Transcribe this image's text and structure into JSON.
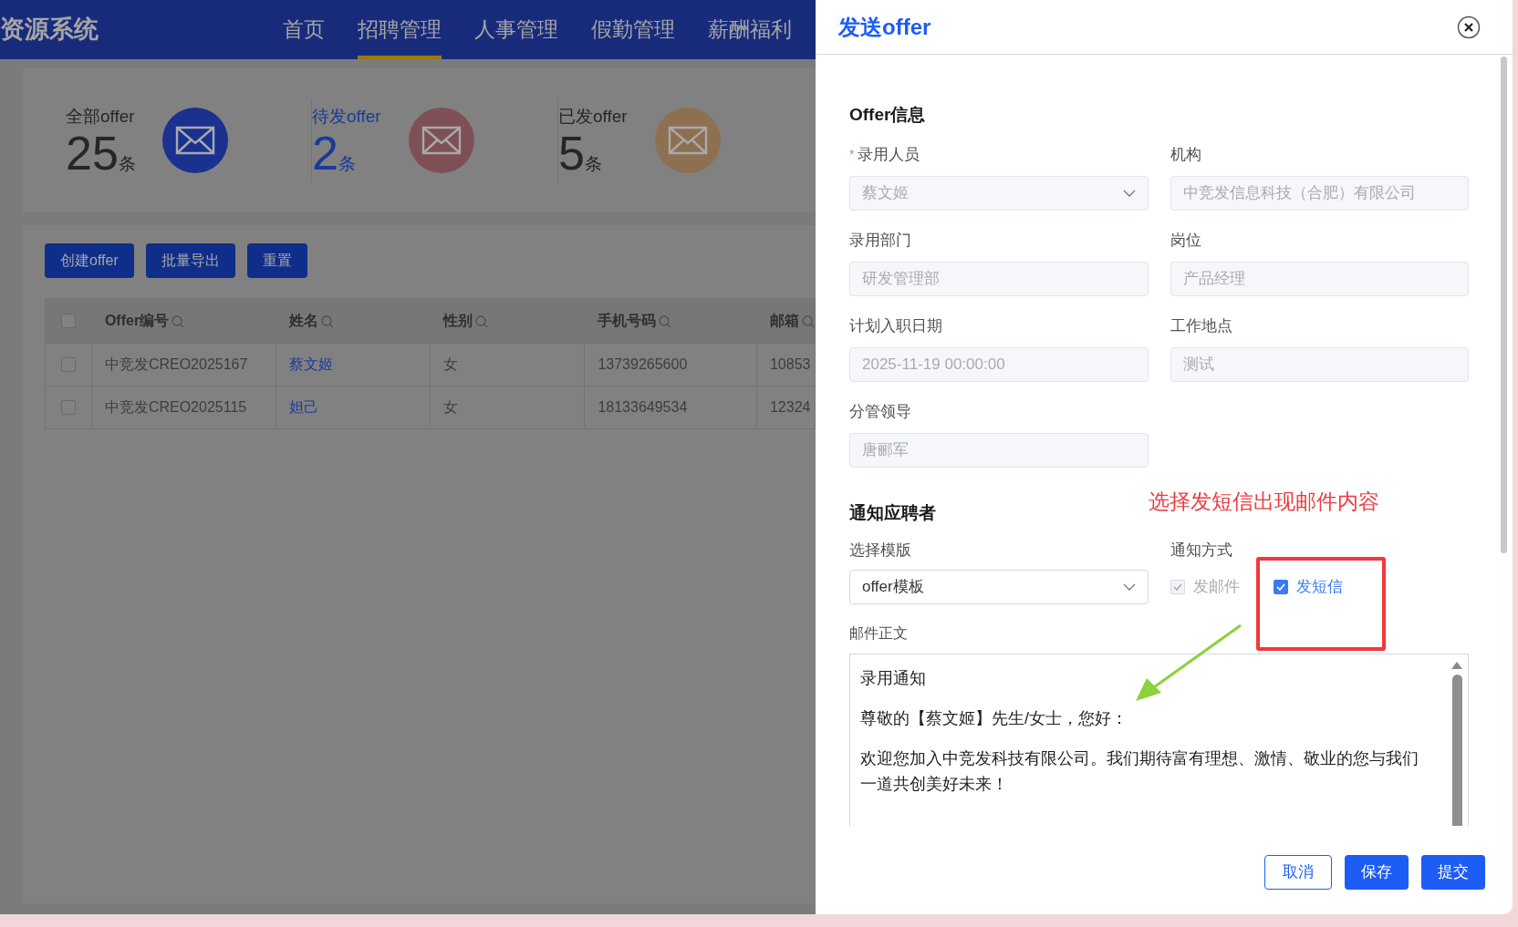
{
  "header": {
    "brand": "资源系统",
    "nav": [
      {
        "label": "首页",
        "selected": false
      },
      {
        "label": "招聘管理",
        "selected": true
      },
      {
        "label": "人事管理",
        "selected": false
      },
      {
        "label": "假勤管理",
        "selected": false
      },
      {
        "label": "薪酬福利",
        "selected": false
      }
    ]
  },
  "stats": [
    {
      "label": "全部offer",
      "count": "25",
      "unit": "条",
      "color": "#1a3190",
      "selected": false
    },
    {
      "label": "待发offer",
      "count": "2",
      "unit": "条",
      "color": "#7e5055",
      "selected": true
    },
    {
      "label": "已发offer",
      "count": "5",
      "unit": "条",
      "color": "#8c7050",
      "selected": false
    }
  ],
  "toolbar": [
    "创建offer",
    "批量导出",
    "重置"
  ],
  "table": {
    "all_checked": false,
    "columns": [
      "Offer编号",
      "姓名",
      "性别",
      "手机号码",
      "邮箱"
    ],
    "rows": [
      {
        "checked": false,
        "cells": [
          "中竞发CREO2025167",
          "蔡文姬",
          "女",
          "13739265600",
          "10853"
        ]
      },
      {
        "checked": false,
        "cells": [
          "中竞发CREO2025115",
          "妲己",
          "女",
          "18133649534",
          "12324"
        ]
      }
    ]
  },
  "drawer": {
    "title": "发送offer",
    "offer_section": {
      "title": "Offer信息",
      "fields": [
        {
          "label": "录用人员",
          "value": "蔡文姬",
          "required_mark": "*",
          "disabled": true,
          "kind": "select"
        },
        {
          "label": "机构",
          "value": "中竞发信息科技（合肥）有限公司",
          "disabled": true,
          "kind": "input"
        },
        {
          "label": "录用部门",
          "value": "研发管理部",
          "disabled": true,
          "kind": "input"
        },
        {
          "label": "岗位",
          "value": "产品经理",
          "disabled": true,
          "kind": "input"
        },
        {
          "label": "计划入职日期",
          "value": "2025-11-19 00:00:00",
          "disabled": true,
          "kind": "input"
        },
        {
          "label": "工作地点",
          "value": "测试",
          "disabled": true,
          "kind": "input"
        },
        {
          "label": "分管领导",
          "value": "唐郦军",
          "disabled": true,
          "kind": "input"
        }
      ]
    },
    "notify_section": {
      "title": "通知应聘者",
      "template": {
        "label": "选择模版",
        "value": "offer模板"
      },
      "method": {
        "label": "通知方式",
        "options": [
          {
            "label": "发邮件",
            "checked": true,
            "disabled": true
          },
          {
            "label": "发短信",
            "checked": true,
            "disabled": false
          }
        ]
      },
      "body_label": "邮件正文",
      "body": [
        "录用通知",
        "尊敬的【蔡文姬】先生/女士，您好：",
        "欢迎您加入中竞发科技有限公司。我们期待富有理想、激情、敬业的您与我们一道共创美好未来！"
      ]
    },
    "annotation": {
      "text": "选择发短信出现邮件内容"
    },
    "buttons": [
      {
        "label": "取消",
        "kind": "secondary"
      },
      {
        "label": "保存",
        "kind": "primary"
      },
      {
        "label": "提交",
        "kind": "primary"
      }
    ]
  }
}
